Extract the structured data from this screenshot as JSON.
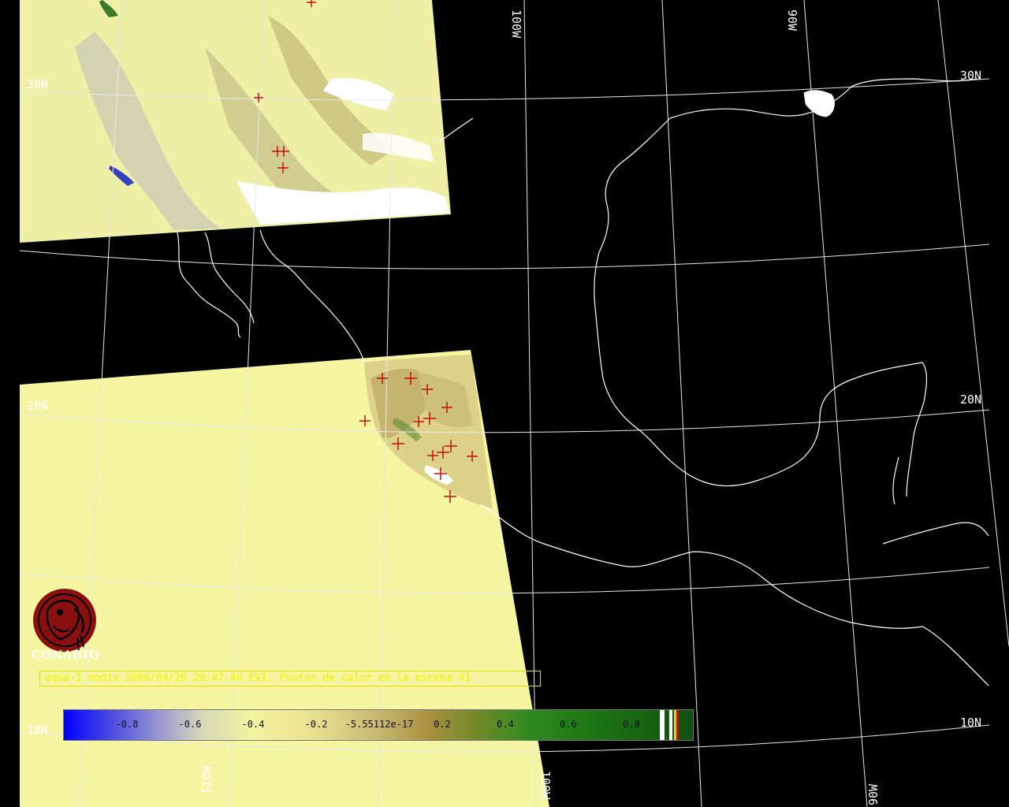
{
  "map": {
    "caption": "aqua-1 modis 2006/04/26 20:47:46 EVI, Puntos de calor en la escena 41",
    "logo_text": "CONABIO",
    "lat_labels": [
      "30N",
      "30N",
      "20N",
      "20N",
      "10N",
      "10N"
    ],
    "lon_labels": [
      "100W",
      "90W",
      "110W",
      "100W",
      "90W"
    ],
    "colors": {
      "background": "#000000",
      "land_fill": "#f4f4a0",
      "coast": "#ffffff",
      "grid": "#e8e8e8",
      "hotspot": "#c41010",
      "caption": "#f2f200",
      "logo": "#8a1010"
    }
  },
  "colorbar": {
    "ticks": [
      "-0.8",
      "-0.6",
      "-0.4",
      "-0.2",
      "-5.55112e-17",
      "0.2",
      "0.4",
      "0.6",
      "0.8"
    ]
  }
}
